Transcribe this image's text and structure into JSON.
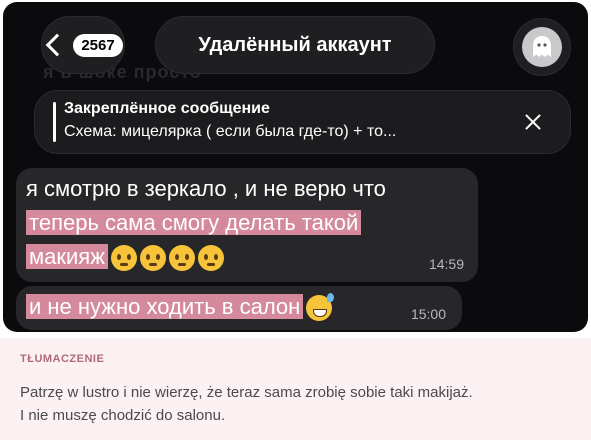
{
  "header": {
    "unread_count": "2567",
    "title": "Удалённый аккаунт"
  },
  "background_text": "я в шоке просто",
  "pinned": {
    "title": "Закреплённое сообщение",
    "text": "Схема: мицелярка ( если была где-то) + то..."
  },
  "messages": [
    {
      "lines": [
        "я смотрю в зеркало , и не верю что",
        "теперь сама смогу делать такой",
        "макияж"
      ],
      "emojis": [
        "pleading-face",
        "pleading-face",
        "pleading-face",
        "pleading-face"
      ],
      "time": "14:59"
    },
    {
      "text": "и не нужно ходить в салон",
      "emoji": "grinning-sweat-face",
      "time": "15:00"
    }
  ],
  "translation": {
    "label": "TŁUMACZENIE",
    "line1": "Patrzę w lustro i nie wierzę, że teraz sama zrobię sobie taki makijaż.",
    "line2": "I nie muszę chodzić do salonu."
  },
  "colors": {
    "chat_bg": "#0b0b0d",
    "bubble": "#27272a",
    "highlight": "#d48a9c",
    "translation_bg": "#fbf1f3"
  }
}
